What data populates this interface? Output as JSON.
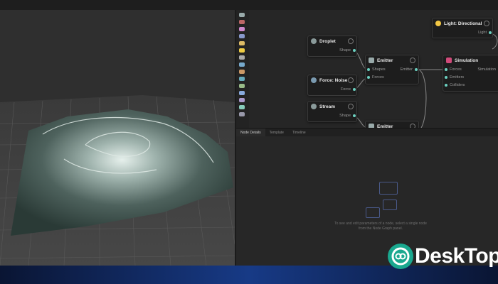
{
  "nodes": {
    "droplet": {
      "title": "Droplet",
      "ports": [
        "Shape"
      ]
    },
    "force_noise": {
      "title": "Force: Noise",
      "ports": [
        "Force"
      ]
    },
    "stream": {
      "title": "Stream",
      "ports": [
        "Shape"
      ]
    },
    "emitter1": {
      "title": "Emitter",
      "in_ports": [
        "Shapes",
        "Forces"
      ],
      "out_ports": [
        "Emitter"
      ]
    },
    "emitter2": {
      "title": "Emitter"
    },
    "light": {
      "title": "Light: Directional",
      "ports": [
        "Light"
      ]
    },
    "simulation": {
      "title": "Simulation",
      "in_ports": [
        "Forces",
        "Emitters",
        "Colliders"
      ],
      "out_ports": [
        "Simulation"
      ]
    }
  },
  "tabs": [
    "Node Details",
    "Template",
    "Timeline"
  ],
  "details_hint": "To see and edit parameters of a node, select a single node from the Node Graph panel.",
  "watermark": "DeskTop",
  "colors": {
    "accent": "#6bd0c0",
    "watermark_green": "#1aa88f",
    "light_icon": "#f2c744",
    "simulation_icon": "#d04a7a"
  }
}
